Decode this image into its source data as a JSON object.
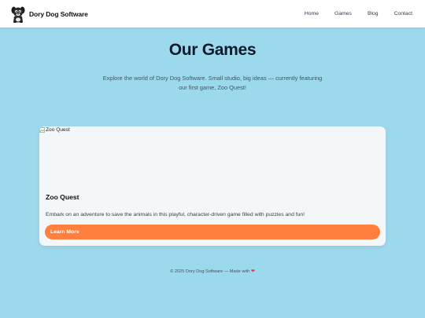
{
  "nav": {
    "brand": "Dory Dog Software",
    "links": [
      "Home",
      "Games",
      "Blog",
      "Contact"
    ]
  },
  "hero": {
    "title": "Our Games",
    "subtitle": "Explore the world of Dory Dog Software. Small studio, big ideas — currently featuring our first game, Zoo Quest!"
  },
  "game_card": {
    "image_alt": "Zoo Quest",
    "title": "Zoo Quest",
    "description": "Embark on an adventure to save the animals in this playful, character-driven game filled with puzzles and fun!",
    "button_label": "Learn More"
  },
  "footer": {
    "text": "© 2025 Dory Dog Software — Made with",
    "heart_icon": "heart-icon"
  },
  "colors": {
    "page_background": "#9dd9ec",
    "navbar_background": "#ffffff",
    "button_accent": "#ff7f3f",
    "heart": "#e63946"
  },
  "icons": {
    "logo": "dog-logo-icon",
    "broken_image": "broken-image-icon"
  }
}
